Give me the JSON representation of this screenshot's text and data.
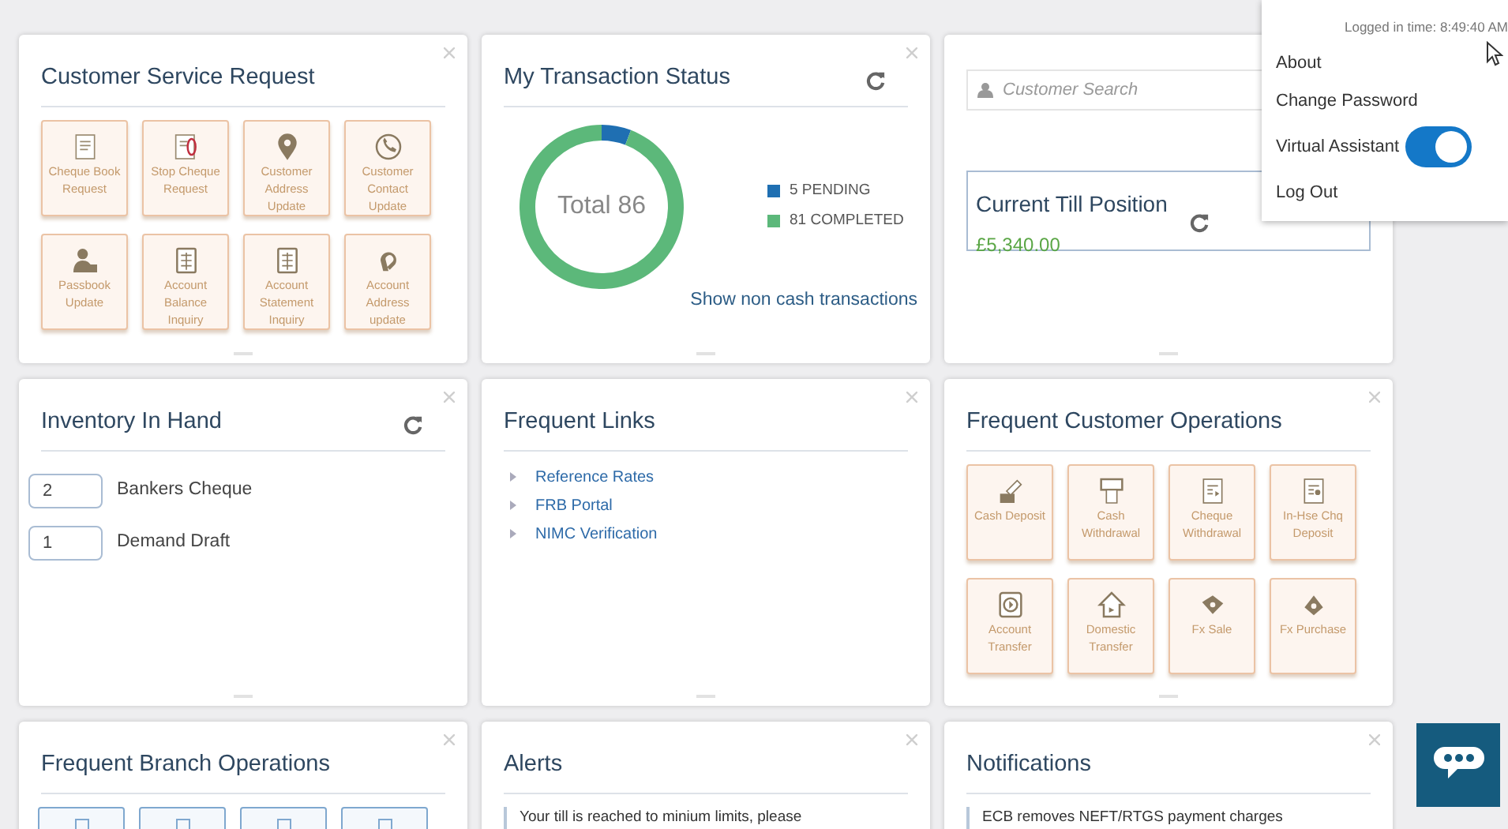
{
  "customer_service_request": {
    "title": "Customer Service Request",
    "tiles": [
      {
        "label": "Cheque Book Request"
      },
      {
        "label": "Stop Cheque Request"
      },
      {
        "label": "Customer Address Update"
      },
      {
        "label": "Customer Contact Update"
      },
      {
        "label": "Passbook Update"
      },
      {
        "label": "Account Balance Inquiry"
      },
      {
        "label": "Account Statement Inquiry"
      },
      {
        "label": "Account Address update"
      }
    ]
  },
  "transaction_status": {
    "title": "My Transaction Status",
    "total": "Total 86",
    "legend": [
      {
        "color": "#1f6fb2"
      },
      {
        "color": "#5cb87a"
      }
    ],
    "chart_data": {
      "type": "donut",
      "categories": [
        "5 PENDING",
        "81 COMPLETED"
      ],
      "series": [
        {
          "values": [
            5,
            81
          ]
        }
      ]
    },
    "link": "Show non cash transactions"
  },
  "till": {
    "search_placeholder": "Customer Search",
    "title": "Current Till Position",
    "amount": "£5,340.00"
  },
  "inventory": {
    "title": "Inventory In Hand",
    "items": [
      {
        "count": "2",
        "label": "Bankers Cheque"
      },
      {
        "count": "1",
        "label": "Demand Draft"
      }
    ]
  },
  "frequent_links": {
    "title": "Frequent Links",
    "links": [
      "Reference Rates",
      "FRB Portal",
      "NIMC Verification"
    ]
  },
  "customer_operations": {
    "title": "Frequent Customer Operations",
    "tiles": [
      {
        "label": "Cash Deposit"
      },
      {
        "label": "Cash Withdrawal"
      },
      {
        "label": "Cheque Withdrawal"
      },
      {
        "label": "In-Hse Chq Deposit"
      },
      {
        "label": "Account Transfer"
      },
      {
        "label": "Domestic Transfer"
      },
      {
        "label": "Fx Sale"
      },
      {
        "label": "Fx Purchase"
      }
    ]
  },
  "branch_operations": {
    "title": "Frequent Branch Operations"
  },
  "alerts": {
    "title": "Alerts",
    "items": [
      "Your till is reached to minium limits, please"
    ]
  },
  "notifications": {
    "title": "Notifications",
    "items": [
      "ECB removes NEFT/RTGS payment charges"
    ]
  },
  "user_menu": {
    "logged_in": "Logged in time: 8:49:40 AM",
    "items": [
      {
        "kind": "link",
        "label": "About"
      },
      {
        "kind": "link",
        "label": "Change Password"
      },
      {
        "kind": "toggle",
        "label": "Virtual Assistant",
        "on": true
      },
      {
        "kind": "link",
        "label": "Log Out"
      }
    ]
  }
}
